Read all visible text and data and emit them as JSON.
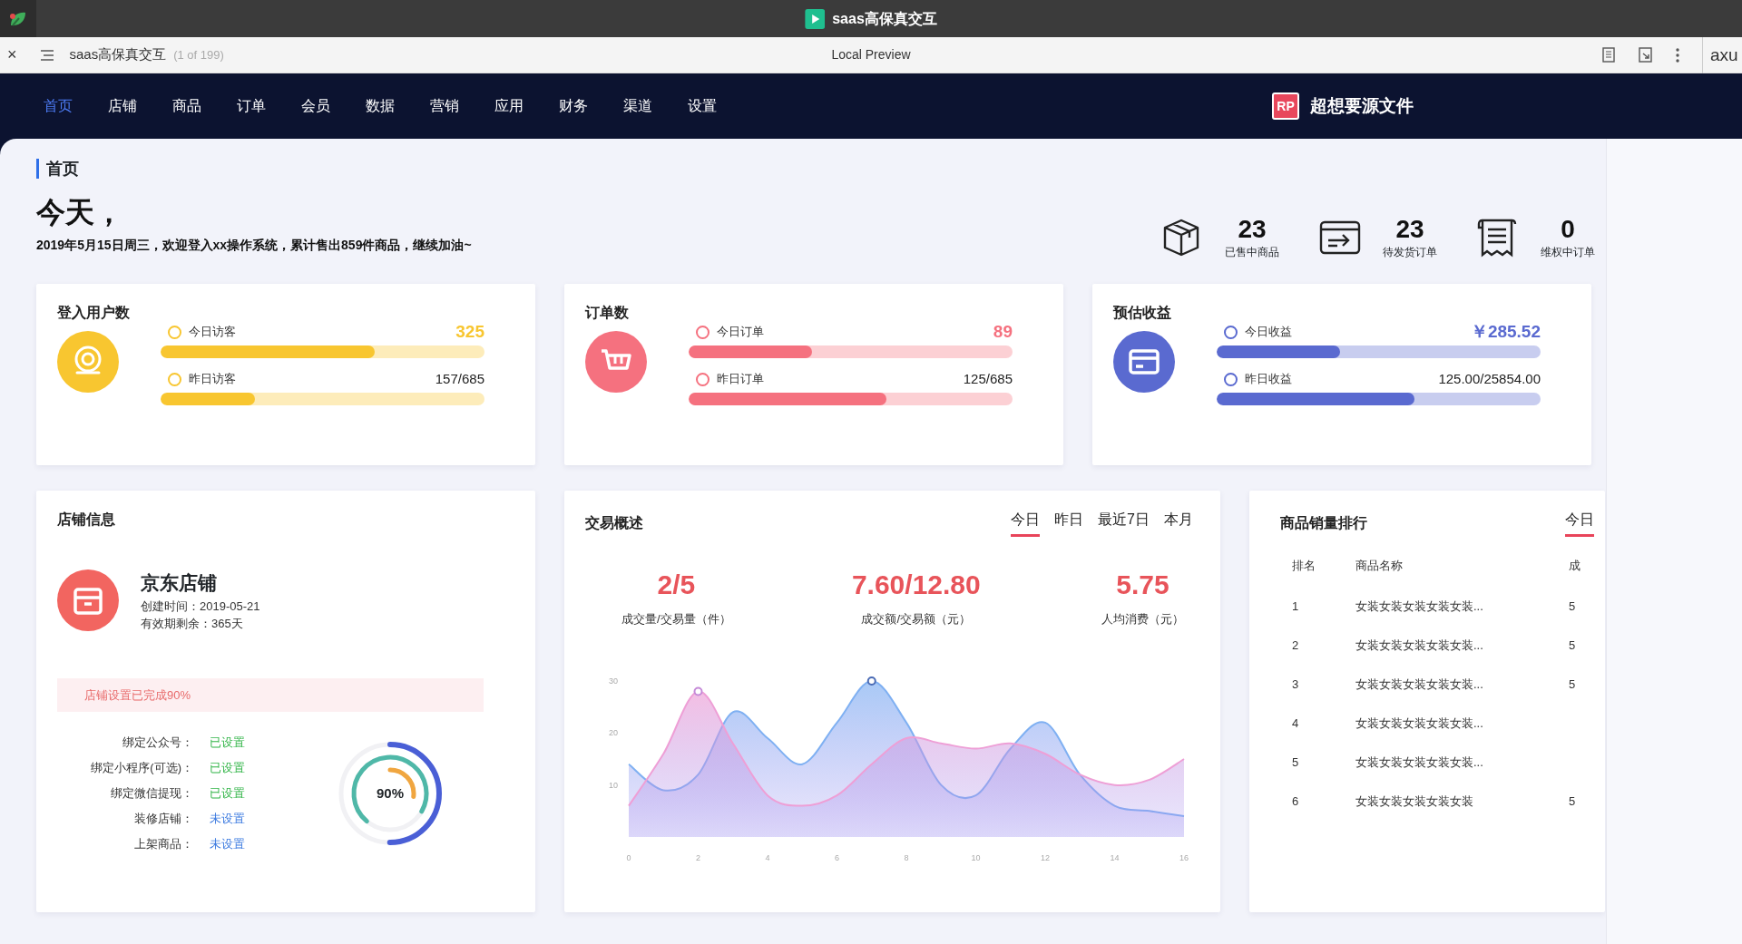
{
  "window": {
    "title": "saas高保真交互"
  },
  "browser": {
    "close_glyph": "×",
    "page_title": "saas高保真交互",
    "page_count": "(1 of 199)",
    "center_title": "Local Preview",
    "right_label": "axu"
  },
  "nav": {
    "items": [
      {
        "label": "首页",
        "selected": true
      },
      {
        "label": "店铺",
        "selected": false
      },
      {
        "label": "商品",
        "selected": false
      },
      {
        "label": "订单",
        "selected": false
      },
      {
        "label": "会员",
        "selected": false
      },
      {
        "label": "数据",
        "selected": false
      },
      {
        "label": "营销",
        "selected": false
      },
      {
        "label": "应用",
        "selected": false
      },
      {
        "label": "财务",
        "selected": false
      },
      {
        "label": "渠道",
        "selected": false
      },
      {
        "label": "设置",
        "selected": false
      }
    ],
    "brand_badge": "RP",
    "brand": "超想要源文件"
  },
  "breadcrumb": "首页",
  "greeting": {
    "title": "今天，",
    "subtitle": "2019年5月15日周三，欢迎登入xx操作系统，累计售出859件商品，继续加油~"
  },
  "summary": [
    {
      "kind": "box",
      "value": "23",
      "label": "已售中商品"
    },
    {
      "kind": "shipping",
      "value": "23",
      "label": "待发货订单"
    },
    {
      "kind": "receipt",
      "value": "0",
      "label": "维权中订单"
    }
  ],
  "metric_cards": [
    {
      "title": "登入用户数",
      "kind": "user",
      "color": "#f8c630",
      "rows": [
        {
          "label": "今日访客",
          "value": "325",
          "level": 0.66,
          "highlight": true
        },
        {
          "label": "昨日访客",
          "value": "157/685",
          "level": 0.29,
          "highlight": false
        }
      ]
    },
    {
      "title": "订单数",
      "kind": "cart",
      "color": "#f5717f",
      "rows": [
        {
          "label": "今日订单",
          "value": "89",
          "level": 0.38,
          "highlight": true
        },
        {
          "label": "昨日订单",
          "value": "125/685",
          "level": 0.61,
          "highlight": false
        }
      ]
    },
    {
      "title": "预估收益",
      "kind": "card",
      "color": "#5a6ad0",
      "rows": [
        {
          "label": "今日收益",
          "value": "￥285.52",
          "level": 0.38,
          "highlight": true
        },
        {
          "label": "昨日收益",
          "value": "125.00/25854.00",
          "level": 0.61,
          "highlight": false
        }
      ]
    }
  ],
  "store": {
    "title": "店铺信息",
    "name": "京东店铺",
    "created": "创建时间：2019-05-21",
    "remaining": "有效期剩余：365天",
    "progress_note": "店铺设置已完成90%",
    "settings": [
      {
        "label": "绑定公众号：",
        "status": "已设置",
        "done": true
      },
      {
        "label": "绑定小程序(可选)：",
        "status": "已设置",
        "done": true
      },
      {
        "label": "绑定微信提现：",
        "status": "已设置",
        "done": true
      },
      {
        "label": "装修店铺：",
        "status": "未设置",
        "done": false
      },
      {
        "label": "上架商品：",
        "status": "未设置",
        "done": false
      }
    ],
    "ring_label": "90%"
  },
  "trade": {
    "title": "交易概述",
    "tabs": [
      {
        "label": "今日",
        "selected": true
      },
      {
        "label": "昨日",
        "selected": false
      },
      {
        "label": "最近7日",
        "selected": false
      },
      {
        "label": "本月",
        "selected": false
      }
    ],
    "stats": [
      {
        "value": "2/5",
        "label": "成交量/交易量（件）"
      },
      {
        "value": "7.60/12.80",
        "label": "成交额/交易额（元）"
      },
      {
        "value": "5.75",
        "label": "人均消费（元）"
      }
    ],
    "chart_data": {
      "type": "area",
      "x": [
        0,
        1,
        2,
        3,
        4,
        5,
        6,
        7,
        8,
        9,
        10,
        11,
        12,
        13,
        14,
        15,
        16
      ],
      "xlim": [
        0,
        16
      ],
      "ylim": [
        0,
        30
      ],
      "xticks": [
        0,
        2,
        4,
        6,
        8,
        10,
        12,
        14,
        16
      ],
      "yticks": [
        10,
        20,
        30
      ],
      "series": [
        {
          "color": "#ee9fd6",
          "values": [
            6,
            16,
            28,
            18,
            8,
            6,
            8,
            14,
            19,
            18,
            17,
            18,
            16,
            12,
            10,
            11,
            15
          ]
        },
        {
          "color": "#7fb0f2",
          "values": [
            14,
            9,
            12,
            24,
            19,
            14,
            22,
            30,
            22,
            10,
            8,
            17,
            22,
            12,
            6,
            5,
            4
          ]
        }
      ]
    }
  },
  "ranking": {
    "title": "商品销量排行",
    "tabs": [
      {
        "label": "今日",
        "selected": true
      }
    ],
    "columns": [
      "排名",
      "商品名称",
      "成"
    ],
    "rows": [
      {
        "rank": "1",
        "name": "女装女装女装女装女装...",
        "column_3": "5"
      },
      {
        "rank": "2",
        "name": "女装女装女装女装女装...",
        "column_3": "5"
      },
      {
        "rank": "3",
        "name": "女装女装女装女装女装...",
        "column_3": "5"
      },
      {
        "rank": "4",
        "name": "女装女装女装女装女装..."
      },
      {
        "rank": "5",
        "name": "女装女装女装女装女装..."
      },
      {
        "rank": "6",
        "name": "女装女装女装女装女装",
        "column_3": "5"
      }
    ]
  }
}
